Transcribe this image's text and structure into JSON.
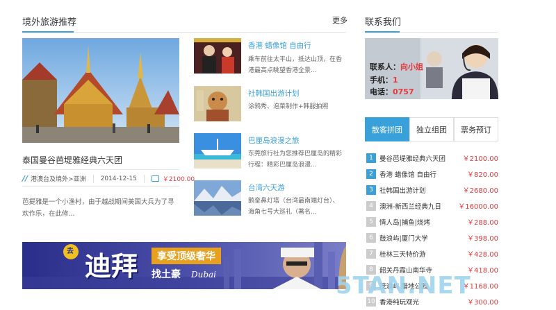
{
  "overseas": {
    "title": "境外旅游推荐",
    "more": "更多",
    "featured": {
      "title": "泰国曼谷芭堤雅经典六天团",
      "category": "港澳台及境外>亚洲",
      "date": "2014-12-15",
      "price": "￥2100.00",
      "desc_line1": "芭提雅是一个小渔村，由于越战期间美国大兵为了寻",
      "desc_line2": "欢作乐，在此修..."
    },
    "items": [
      {
        "title": "香港 蜡像馆 自由行",
        "line1": "乘车前往太平山，抵达山顶，在香",
        "line2": "港最高点眺望香港全景..."
      },
      {
        "title": "社韩国出游计划",
        "line1": "涂鸦秀、泡菜制作+韩服拍照",
        "line2": ""
      },
      {
        "title": "巴厘岛浪漫之旅",
        "line1": "东莞旅行社为您推荐巴厘岛的精彩",
        "line2": "行程：精彩巴厘岛浪漫..."
      },
      {
        "title": "台湾六天游",
        "line1": "鹅銮鼻灯塔（台湾最南端灯台）、",
        "line2": "海角七号大巡礼（著名..."
      }
    ]
  },
  "banner": {
    "main": "迪拜",
    "tagline": "享受顶级奢华",
    "sub": "找土豪",
    "script": "Dubai"
  },
  "contact": {
    "title": "联系我们",
    "name_label": "联系人：",
    "name_value": "向小姐",
    "phone_label": "手机：",
    "phone_value": "1",
    "tel_label": "电话：",
    "tel_value": "0757"
  },
  "tabs": [
    "散客拼团",
    "独立组团",
    "票务预订"
  ],
  "ranking": [
    {
      "num": "1",
      "name": "曼谷芭堤雅经典六天团",
      "price": "￥2100.00"
    },
    {
      "num": "2",
      "name": "香港 蜡像馆 自由行",
      "price": "￥820.00"
    },
    {
      "num": "3",
      "name": "社韩国出游计划",
      "price": "￥2680.00"
    },
    {
      "num": "4",
      "name": "澳洲-新西兰经典九日",
      "price": "￥16000.00"
    },
    {
      "num": "5",
      "name": "情人岛|捕鱼|烧烤",
      "price": "￥288.00"
    },
    {
      "num": "6",
      "name": "鼓浪屿|厦门大学",
      "price": "￥398.00"
    },
    {
      "num": "7",
      "name": "桂林三天特价游",
      "price": "￥428.00"
    },
    {
      "num": "8",
      "name": "韶关丹霞山南华寺",
      "price": "￥418.00"
    },
    {
      "num": "9",
      "name": "茂浪屿 腊地公园",
      "price": "￥1168.00"
    },
    {
      "num": "10",
      "name": "香港纯玩观光",
      "price": "￥300.00"
    }
  ],
  "watermark": "5TAN.NET",
  "colors": {
    "accent": "#3aa0d9",
    "price": "#e4393c"
  }
}
